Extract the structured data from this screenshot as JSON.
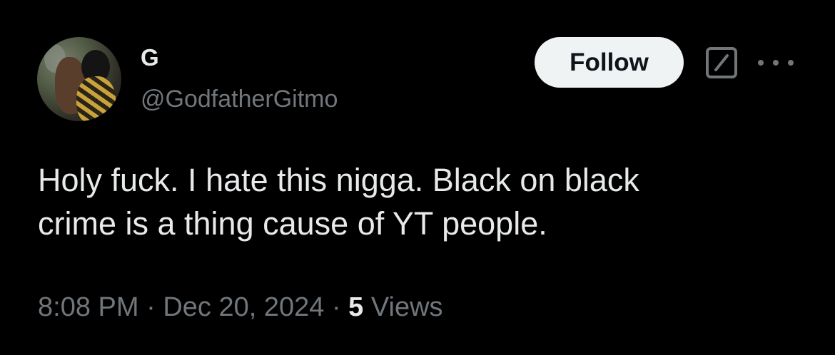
{
  "author": {
    "display_name": "G",
    "handle": "@GodfatherGitmo"
  },
  "actions": {
    "follow_label": "Follow",
    "grok_icon": "grok-icon",
    "more_icon": "more-icon"
  },
  "tweet": {
    "text_lines": [
      "Holy fuck. I hate this nigga. Black on black",
      "crime is a thing cause of YT people."
    ],
    "time": "8:08 PM",
    "separator": "·",
    "date": "Dec 20, 2024",
    "views_count": "5",
    "views_label": "Views"
  },
  "colors": {
    "background": "#000000",
    "primary_text": "#e7e9ea",
    "secondary_text": "#71767b",
    "follow_button_bg": "#eff3f4"
  }
}
